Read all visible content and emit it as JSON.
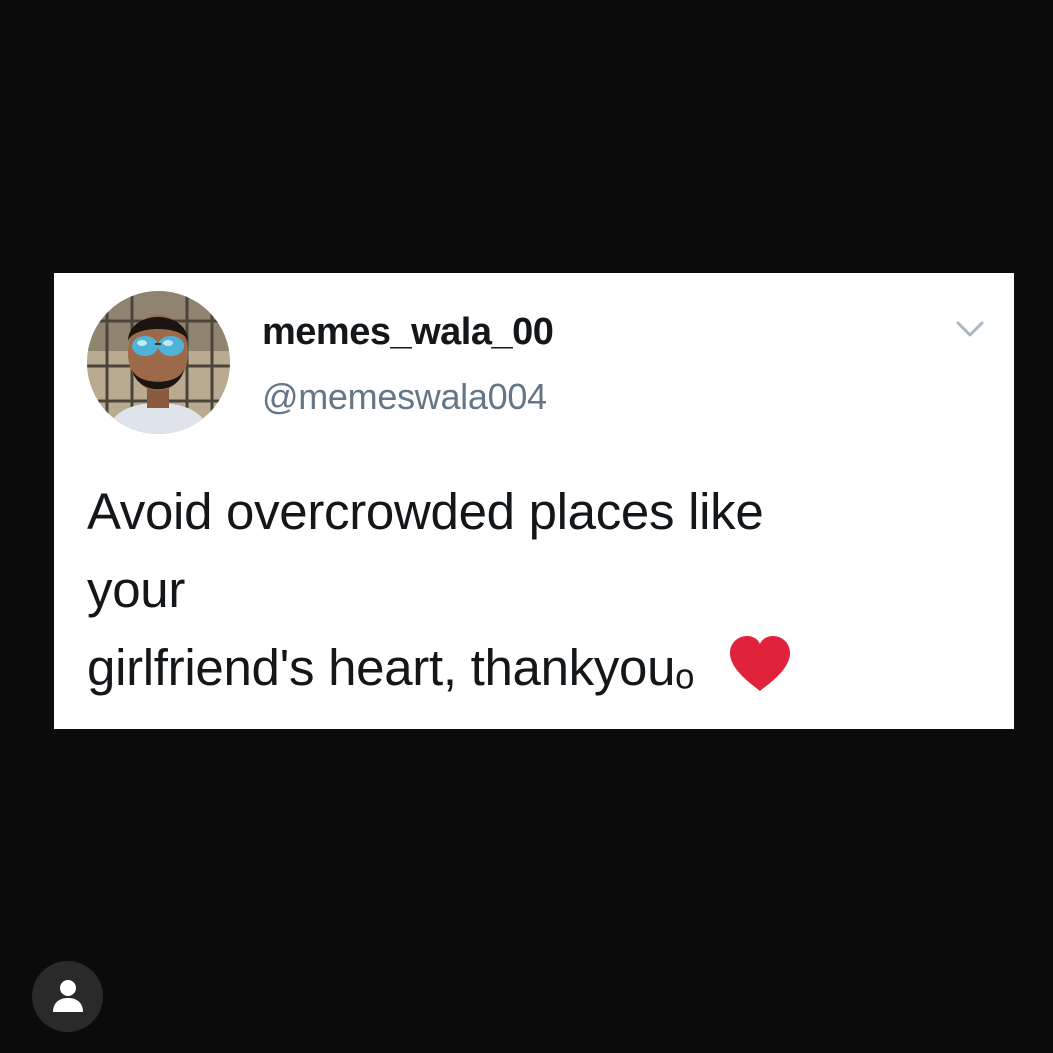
{
  "tweet": {
    "display_name": "memes_wala_00",
    "handle": "@memeswala004",
    "text_lines": [
      "Avoid overcrowded places like",
      "your",
      "girlfriend's heart, thankyouₒ"
    ],
    "trailing_icon": "heart-icon",
    "avatar_icon": "avatar",
    "menu_icon": "chevron-down-icon"
  },
  "overlay": {
    "profile_icon": "user-icon"
  },
  "colors": {
    "background": "#0b0b0b",
    "card": "#ffffff",
    "text": "#14171a",
    "handle": "#657786",
    "chevron": "#aab8c2",
    "heart": "#e0223b",
    "profile_button": "#2a2a2a"
  }
}
